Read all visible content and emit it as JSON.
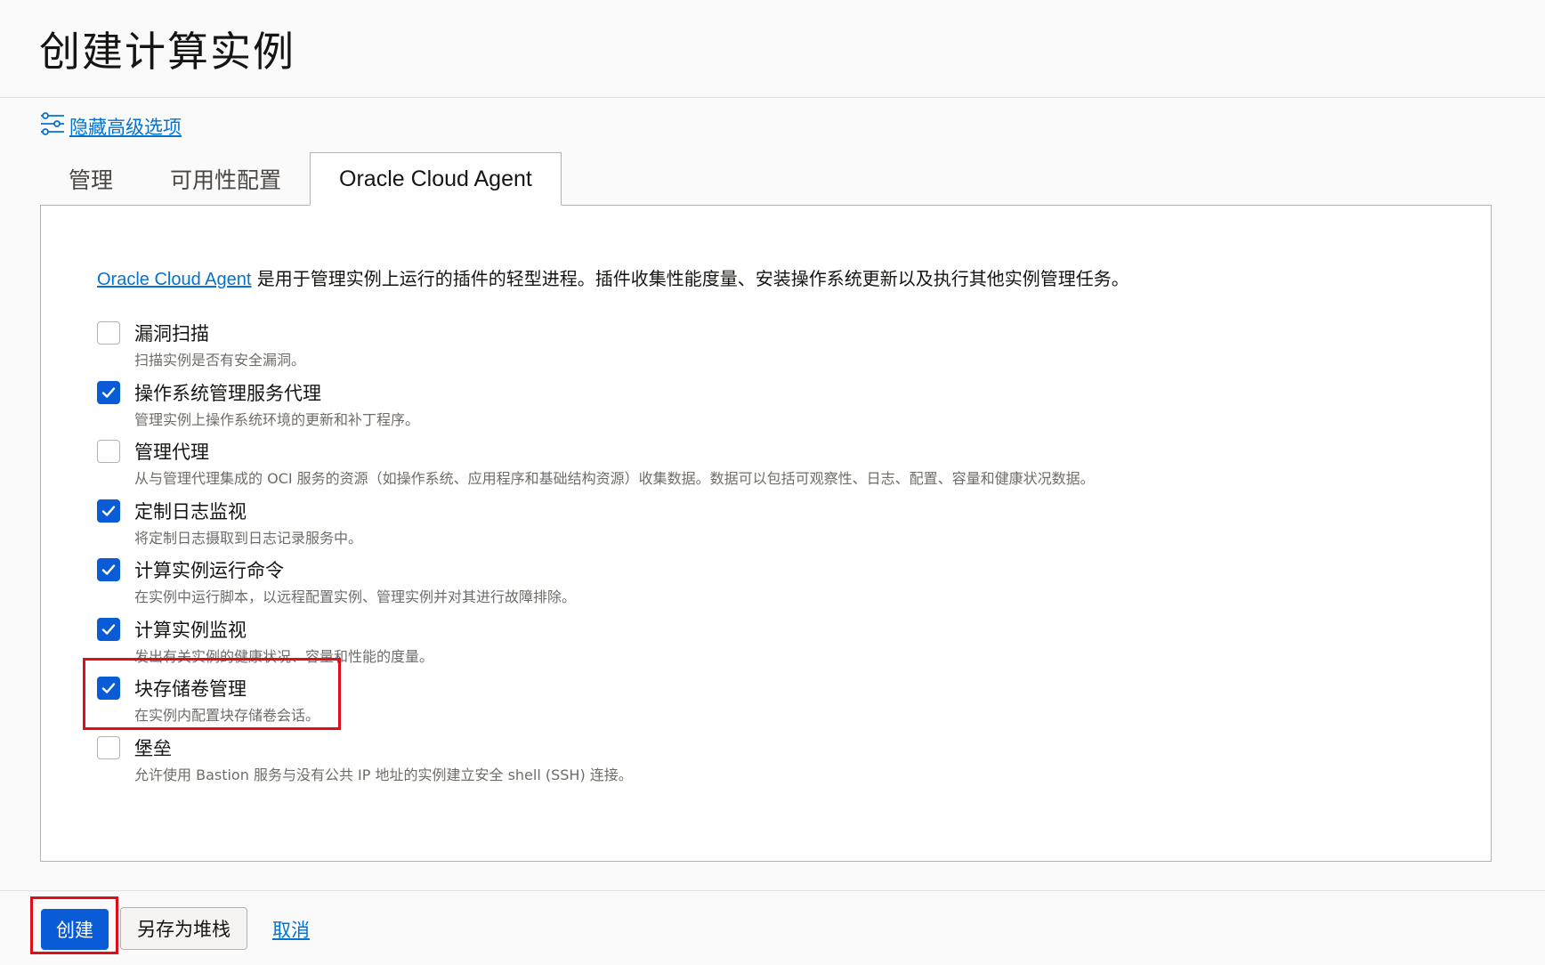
{
  "header": {
    "title": "创建计算实例"
  },
  "advanced": {
    "link_label": "隐藏高级选项",
    "icon": "sliders-icon"
  },
  "tabs": [
    {
      "label": "管理",
      "active": false
    },
    {
      "label": "可用性配置",
      "active": false
    },
    {
      "label": "Oracle Cloud Agent",
      "active": true
    }
  ],
  "intro": {
    "link_text": "Oracle Cloud Agent",
    "text": " 是用于管理实例上运行的插件的轻型进程。插件收集性能度量、安装操作系统更新以及执行其他实例管理任务。"
  },
  "plugins": [
    {
      "name": "漏洞扫描",
      "description": "扫描实例是否有安全漏洞。",
      "checked": false
    },
    {
      "name": "操作系统管理服务代理",
      "description": "管理实例上操作系统环境的更新和补丁程序。",
      "checked": true
    },
    {
      "name": "管理代理",
      "description": "从与管理代理集成的 OCI 服务的资源（如操作系统、应用程序和基础结构资源）收集数据。数据可以包括可观察性、日志、配置、容量和健康状况数据。",
      "checked": false
    },
    {
      "name": "定制日志监视",
      "description": "将定制日志摄取到日志记录服务中。",
      "checked": true
    },
    {
      "name": "计算实例运行命令",
      "description": "在实例中运行脚本，以远程配置实例、管理实例并对其进行故障排除。",
      "checked": true
    },
    {
      "name": "计算实例监视",
      "description": "发出有关实例的健康状况、容量和性能的度量。",
      "checked": true
    },
    {
      "name": "块存储卷管理",
      "description": "在实例内配置块存储卷会话。",
      "checked": true
    },
    {
      "name": "堡垒",
      "description": "允许使用 Bastion 服务与没有公共 IP 地址的实例建立安全 shell (SSH) 连接。",
      "checked": false
    }
  ],
  "footer": {
    "create_label": "创建",
    "save_stack_label": "另存为堆栈",
    "cancel_label": "取消"
  },
  "colors": {
    "accent": "#0a5bd6",
    "link": "#0572ce",
    "highlight": "#e00d1a"
  }
}
